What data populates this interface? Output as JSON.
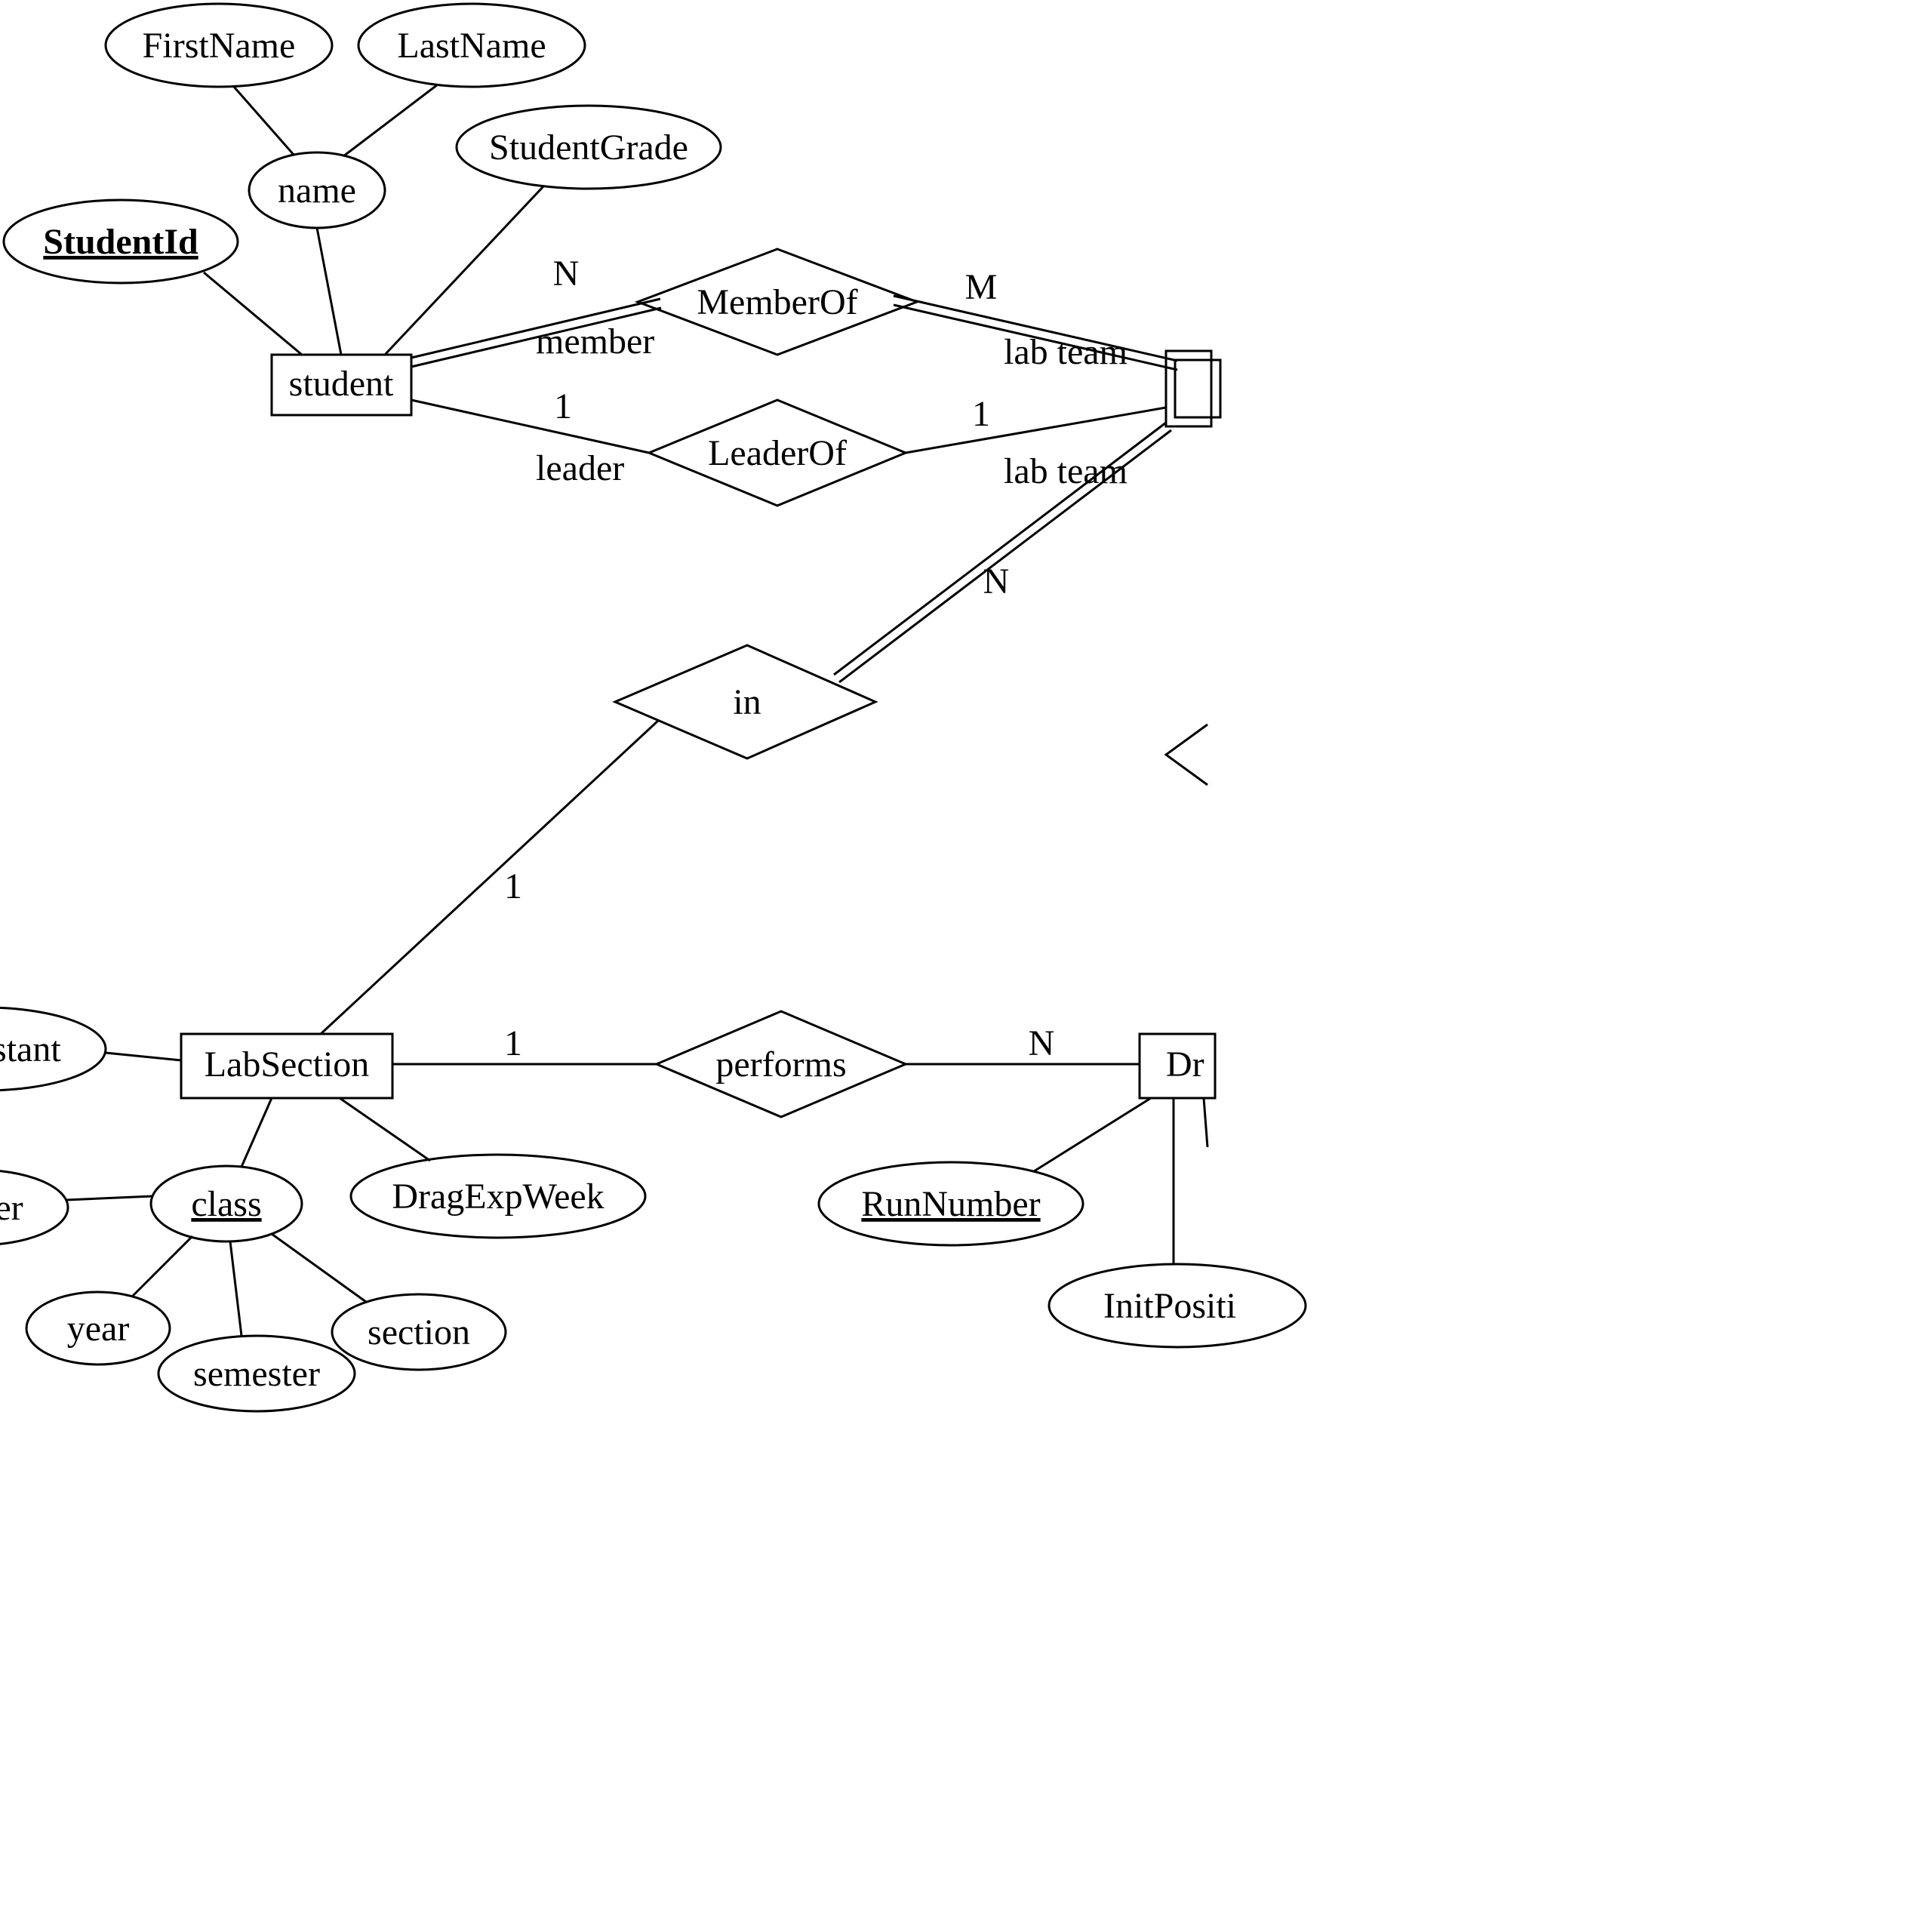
{
  "entities": {
    "student": "student",
    "labSection": "LabSection",
    "dragExperiment": "Dr"
  },
  "relationships": {
    "memberOf": "MemberOf",
    "leaderOf": "LeaderOf",
    "in": "in",
    "performs": "performs"
  },
  "attributes": {
    "firstName": "FirstName",
    "lastName": "LastName",
    "name": "name",
    "studentId": "StudentId",
    "studentGrade": "StudentGrade",
    "assistant": "ssistant",
    "number": "ber",
    "class": "class",
    "year": "year",
    "semester": "semester",
    "section": "section",
    "dragExpWeek": "DragExpWeek",
    "runNumber": "RunNumber",
    "initPosition": "InitPositi"
  },
  "cardinalities": {
    "n": "N",
    "m": "M",
    "one": "1"
  },
  "roles": {
    "member": "member",
    "leader": "leader",
    "labTeam": "lab team"
  }
}
